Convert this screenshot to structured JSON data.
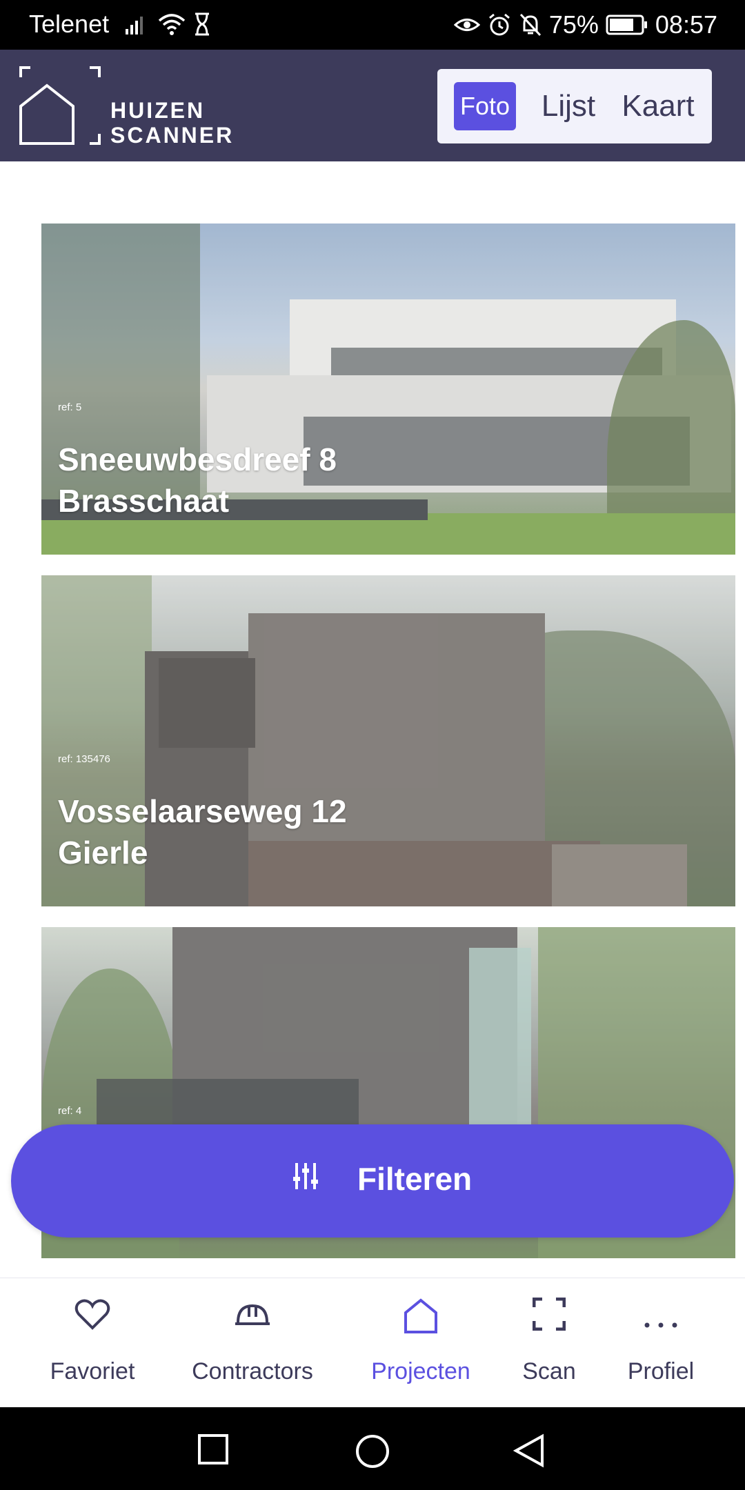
{
  "status_bar": {
    "carrier": "Telenet",
    "battery": "75%",
    "time": "08:57"
  },
  "header": {
    "brand_line1": "HUIZEN",
    "brand_line2": "SCANNER",
    "view_tabs": [
      {
        "label": "Foto",
        "active": true
      },
      {
        "label": "Lijst",
        "active": false
      },
      {
        "label": "Kaart",
        "active": false
      }
    ]
  },
  "projects": [
    {
      "ref": "ref: 5",
      "street": "Sneeuwbesdreef 8",
      "city": "Brasschaat"
    },
    {
      "ref": "ref: 135476",
      "street": "Vosselaarseweg 12",
      "city": "Gierle"
    },
    {
      "ref": "ref: 4"
    }
  ],
  "filter_button": {
    "label": "Filteren",
    "icon": "sliders-icon"
  },
  "bottom_nav": [
    {
      "label": "Favoriet",
      "icon": "heart-icon",
      "active": false
    },
    {
      "label": "Contractors",
      "icon": "hardhat-icon",
      "active": false
    },
    {
      "label": "Projecten",
      "icon": "home-icon",
      "active": true
    },
    {
      "label": "Scan",
      "icon": "scan-icon",
      "active": false
    },
    {
      "label": "Profiel",
      "icon": "more-icon",
      "active": false
    }
  ],
  "colors": {
    "primary": "#5b50e0",
    "header_bg": "#3d3b5b",
    "active_nav": "#5b50e0"
  }
}
